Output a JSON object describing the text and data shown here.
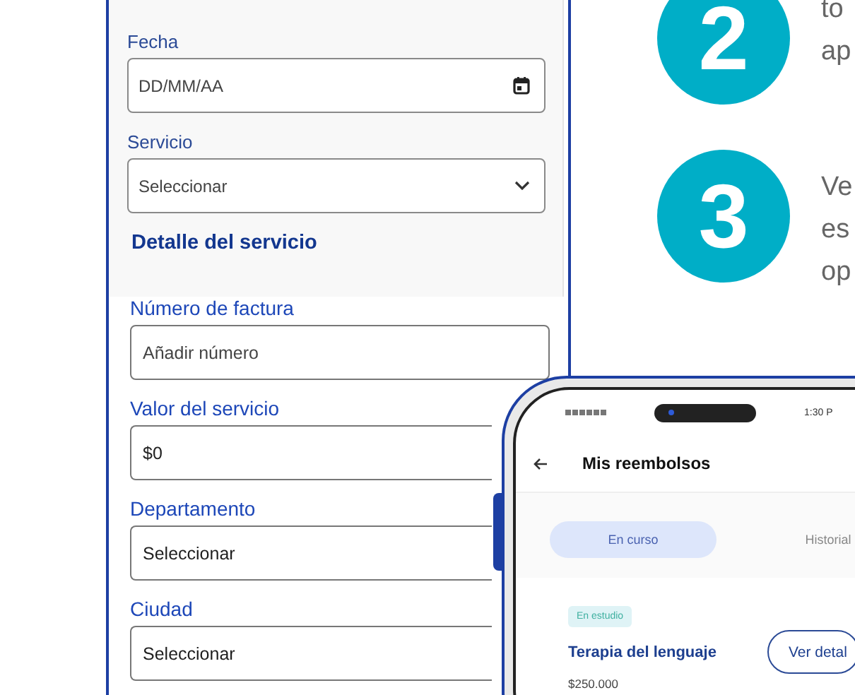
{
  "form": {
    "top_fields": [
      {
        "kind": "date",
        "label": "Fecha",
        "placeholder": "DD/MM/AA"
      },
      {
        "kind": "select",
        "label": "Servicio",
        "placeholder": "Seleccionar"
      }
    ],
    "section_title": "Detalle del servicio",
    "detail_fields": [
      {
        "kind": "text",
        "label": "Número de factura",
        "placeholder": "Añadir número"
      },
      {
        "kind": "text",
        "label": "Valor del servicio",
        "value": "$0"
      },
      {
        "kind": "select",
        "label": "Departamento",
        "placeholder": "Seleccionar"
      },
      {
        "kind": "select",
        "label": "Ciudad",
        "placeholder": "Seleccionar"
      }
    ]
  },
  "steps": [
    {
      "number": "2",
      "lines": [
        "to",
        "ap"
      ]
    },
    {
      "number": "3",
      "lines": [
        "Ve",
        "es",
        "op"
      ]
    }
  ],
  "phone": {
    "status_time": "1:30 P",
    "title": "Mis reembolsos",
    "tabs": [
      {
        "label": "En curso",
        "selected": true
      },
      {
        "label": "Historial",
        "selected": false
      }
    ],
    "card": {
      "badge": "En estudio",
      "title": "Terapia del lenguaje",
      "amount": "$250.000",
      "button": "Ver detal"
    }
  }
}
